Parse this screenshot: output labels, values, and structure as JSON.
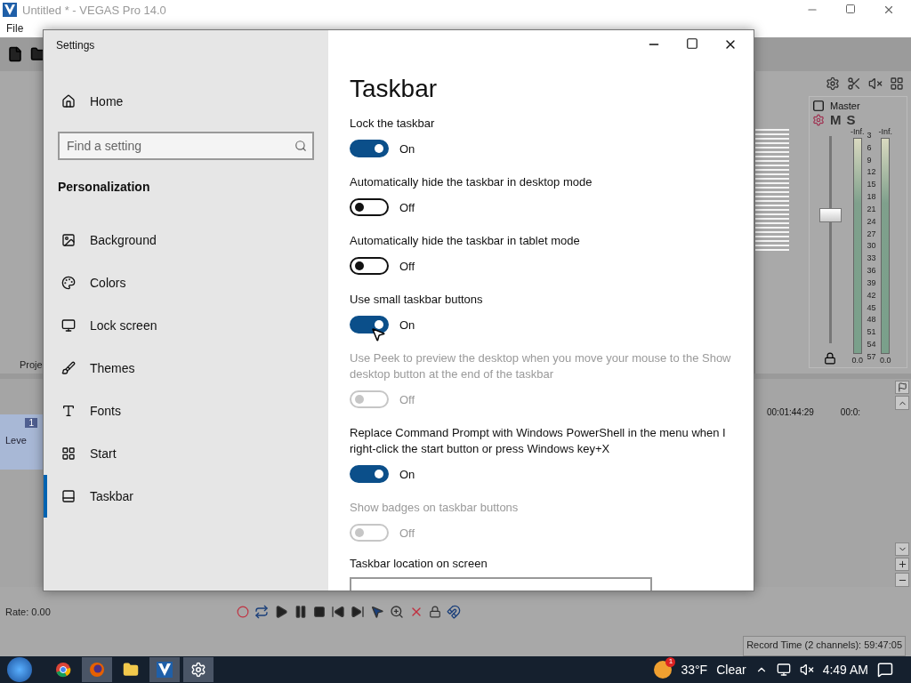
{
  "app": {
    "title": "Untitled * - VEGAS Pro 14.0",
    "menu": [
      "File"
    ]
  },
  "project_tab": "Proje",
  "mixer": {
    "bus": "Master",
    "mute": "M",
    "solo": "S",
    "peaks": [
      "-Inf.",
      "-Inf."
    ],
    "scale": [
      "3",
      "6",
      "9",
      "12",
      "15",
      "18",
      "21",
      "24",
      "27",
      "30",
      "33",
      "36",
      "39",
      "42",
      "45",
      "48",
      "51",
      "54",
      "57"
    ],
    "readings": [
      "0.0",
      "0.0"
    ],
    "level": 0.62
  },
  "track": {
    "number": "1",
    "label": "Leve"
  },
  "timeline": {
    "ticks": [
      "00:01:44:29",
      "00:0:"
    ]
  },
  "rate": "Rate: 0.00",
  "status": "Record Time (2 channels): 59:47:05",
  "settings": {
    "title": "Settings",
    "home": "Home",
    "search": {
      "placeholder": "Find a setting"
    },
    "section": "Personalization",
    "items": [
      {
        "kind": "background",
        "label": "Background",
        "selected": false
      },
      {
        "kind": "colors",
        "label": "Colors",
        "selected": false
      },
      {
        "kind": "lock",
        "label": "Lock screen",
        "selected": false
      },
      {
        "kind": "themes",
        "label": "Themes",
        "selected": false
      },
      {
        "kind": "fonts",
        "label": "Fonts",
        "selected": false
      },
      {
        "kind": "start",
        "label": "Start",
        "selected": false
      },
      {
        "kind": "taskbar",
        "label": "Taskbar",
        "selected": true
      }
    ],
    "page_title": "Taskbar",
    "options": [
      {
        "label": "Lock the taskbar",
        "status": "On",
        "on": true,
        "disabled": false
      },
      {
        "label": "Automatically hide the taskbar in desktop mode",
        "status": "Off",
        "on": false,
        "disabled": false
      },
      {
        "label": "Automatically hide the taskbar in tablet mode",
        "status": "Off",
        "on": false,
        "disabled": false
      },
      {
        "label": "Use small taskbar buttons",
        "status": "On",
        "on": true,
        "disabled": false
      },
      {
        "label": "Use Peek to preview the desktop when you move your mouse to the Show desktop button at the end of the taskbar",
        "status": "Off",
        "on": false,
        "disabled": true
      },
      {
        "label": "Replace Command Prompt with Windows PowerShell in the menu when I right-click the start button or press Windows key+X",
        "status": "On",
        "on": true,
        "disabled": false
      },
      {
        "label": "Show badges on taskbar buttons",
        "status": "Off",
        "on": false,
        "disabled": true
      }
    ],
    "location_heading": "Taskbar location on screen"
  },
  "taskbar": {
    "apps": [
      {
        "kind": "chrome",
        "selected": false
      },
      {
        "kind": "firefox",
        "selected": true
      },
      {
        "kind": "folder",
        "selected": false
      },
      {
        "kind": "vegas",
        "selected": true
      },
      {
        "kind": "settings",
        "selected": true
      }
    ],
    "weather_badge": "1",
    "temperature": "33°F",
    "condition": "Clear",
    "time": "4:49 AM"
  }
}
